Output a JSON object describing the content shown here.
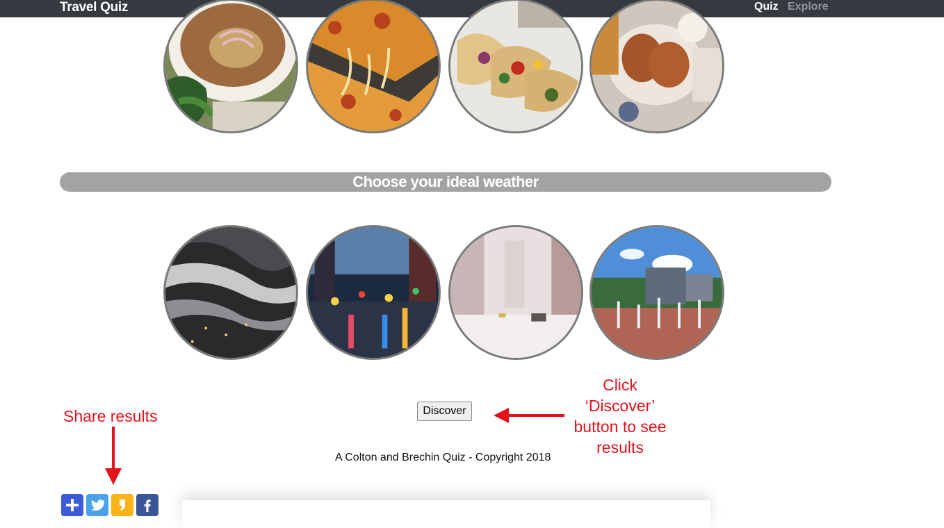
{
  "navbar": {
    "brand": "Travel Quiz",
    "links": [
      {
        "label": "Quiz",
        "active": true
      },
      {
        "label": "Explore",
        "active": false
      }
    ]
  },
  "food_options": [
    {
      "name": "pho-soup"
    },
    {
      "name": "pizza"
    },
    {
      "name": "tacos"
    },
    {
      "name": "fried-chicken"
    }
  ],
  "weather_section": {
    "heading": "Choose your ideal weather"
  },
  "weather_options": [
    {
      "name": "fog"
    },
    {
      "name": "rain"
    },
    {
      "name": "snow"
    },
    {
      "name": "sunny"
    }
  ],
  "discover_button": {
    "label": "Discover"
  },
  "footer": {
    "text": "A Colton and Brechin Quiz - Copyright 2018"
  },
  "annotations": {
    "share": "Share results",
    "click_lines": [
      "Click",
      "‘Discover’",
      "button to see",
      "results"
    ],
    "color": "#e3121b"
  },
  "share_buttons": [
    {
      "name": "addthis",
      "icon": "plus-icon",
      "color": "#3b5bd8"
    },
    {
      "name": "twitter",
      "icon": "twitter-icon",
      "color": "#4aa3ea"
    },
    {
      "name": "kakao-story",
      "icon": "quote-icon",
      "color": "#f8b317"
    },
    {
      "name": "facebook",
      "icon": "facebook-icon",
      "color": "#3b5696"
    }
  ]
}
